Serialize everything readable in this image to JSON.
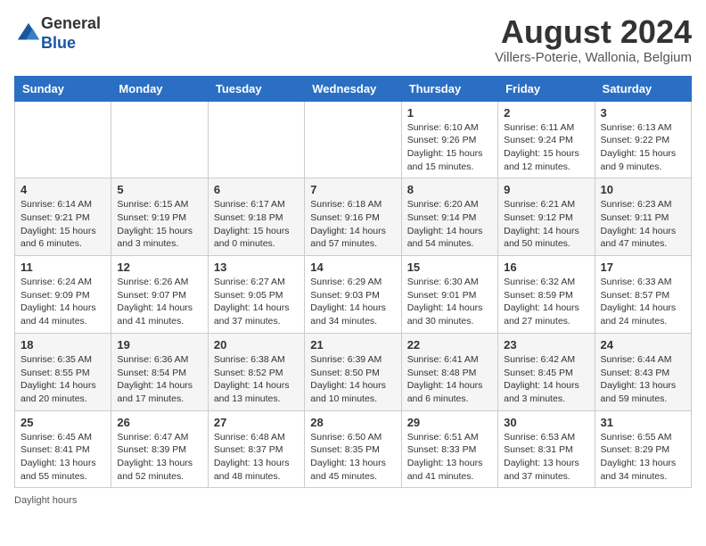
{
  "header": {
    "logo_line1": "General",
    "logo_line2": "Blue",
    "main_title": "August 2024",
    "subtitle": "Villers-Poterie, Wallonia, Belgium"
  },
  "days_of_week": [
    "Sunday",
    "Monday",
    "Tuesday",
    "Wednesday",
    "Thursday",
    "Friday",
    "Saturday"
  ],
  "footer": {
    "daylight_label": "Daylight hours"
  },
  "weeks": [
    [
      {
        "day": "",
        "info": ""
      },
      {
        "day": "",
        "info": ""
      },
      {
        "day": "",
        "info": ""
      },
      {
        "day": "",
        "info": ""
      },
      {
        "day": "1",
        "info": "Sunrise: 6:10 AM\nSunset: 9:26 PM\nDaylight: 15 hours and 15 minutes."
      },
      {
        "day": "2",
        "info": "Sunrise: 6:11 AM\nSunset: 9:24 PM\nDaylight: 15 hours and 12 minutes."
      },
      {
        "day": "3",
        "info": "Sunrise: 6:13 AM\nSunset: 9:22 PM\nDaylight: 15 hours and 9 minutes."
      }
    ],
    [
      {
        "day": "4",
        "info": "Sunrise: 6:14 AM\nSunset: 9:21 PM\nDaylight: 15 hours and 6 minutes."
      },
      {
        "day": "5",
        "info": "Sunrise: 6:15 AM\nSunset: 9:19 PM\nDaylight: 15 hours and 3 minutes."
      },
      {
        "day": "6",
        "info": "Sunrise: 6:17 AM\nSunset: 9:18 PM\nDaylight: 15 hours and 0 minutes."
      },
      {
        "day": "7",
        "info": "Sunrise: 6:18 AM\nSunset: 9:16 PM\nDaylight: 14 hours and 57 minutes."
      },
      {
        "day": "8",
        "info": "Sunrise: 6:20 AM\nSunset: 9:14 PM\nDaylight: 14 hours and 54 minutes."
      },
      {
        "day": "9",
        "info": "Sunrise: 6:21 AM\nSunset: 9:12 PM\nDaylight: 14 hours and 50 minutes."
      },
      {
        "day": "10",
        "info": "Sunrise: 6:23 AM\nSunset: 9:11 PM\nDaylight: 14 hours and 47 minutes."
      }
    ],
    [
      {
        "day": "11",
        "info": "Sunrise: 6:24 AM\nSunset: 9:09 PM\nDaylight: 14 hours and 44 minutes."
      },
      {
        "day": "12",
        "info": "Sunrise: 6:26 AM\nSunset: 9:07 PM\nDaylight: 14 hours and 41 minutes."
      },
      {
        "day": "13",
        "info": "Sunrise: 6:27 AM\nSunset: 9:05 PM\nDaylight: 14 hours and 37 minutes."
      },
      {
        "day": "14",
        "info": "Sunrise: 6:29 AM\nSunset: 9:03 PM\nDaylight: 14 hours and 34 minutes."
      },
      {
        "day": "15",
        "info": "Sunrise: 6:30 AM\nSunset: 9:01 PM\nDaylight: 14 hours and 30 minutes."
      },
      {
        "day": "16",
        "info": "Sunrise: 6:32 AM\nSunset: 8:59 PM\nDaylight: 14 hours and 27 minutes."
      },
      {
        "day": "17",
        "info": "Sunrise: 6:33 AM\nSunset: 8:57 PM\nDaylight: 14 hours and 24 minutes."
      }
    ],
    [
      {
        "day": "18",
        "info": "Sunrise: 6:35 AM\nSunset: 8:55 PM\nDaylight: 14 hours and 20 minutes."
      },
      {
        "day": "19",
        "info": "Sunrise: 6:36 AM\nSunset: 8:54 PM\nDaylight: 14 hours and 17 minutes."
      },
      {
        "day": "20",
        "info": "Sunrise: 6:38 AM\nSunset: 8:52 PM\nDaylight: 14 hours and 13 minutes."
      },
      {
        "day": "21",
        "info": "Sunrise: 6:39 AM\nSunset: 8:50 PM\nDaylight: 14 hours and 10 minutes."
      },
      {
        "day": "22",
        "info": "Sunrise: 6:41 AM\nSunset: 8:48 PM\nDaylight: 14 hours and 6 minutes."
      },
      {
        "day": "23",
        "info": "Sunrise: 6:42 AM\nSunset: 8:45 PM\nDaylight: 14 hours and 3 minutes."
      },
      {
        "day": "24",
        "info": "Sunrise: 6:44 AM\nSunset: 8:43 PM\nDaylight: 13 hours and 59 minutes."
      }
    ],
    [
      {
        "day": "25",
        "info": "Sunrise: 6:45 AM\nSunset: 8:41 PM\nDaylight: 13 hours and 55 minutes."
      },
      {
        "day": "26",
        "info": "Sunrise: 6:47 AM\nSunset: 8:39 PM\nDaylight: 13 hours and 52 minutes."
      },
      {
        "day": "27",
        "info": "Sunrise: 6:48 AM\nSunset: 8:37 PM\nDaylight: 13 hours and 48 minutes."
      },
      {
        "day": "28",
        "info": "Sunrise: 6:50 AM\nSunset: 8:35 PM\nDaylight: 13 hours and 45 minutes."
      },
      {
        "day": "29",
        "info": "Sunrise: 6:51 AM\nSunset: 8:33 PM\nDaylight: 13 hours and 41 minutes."
      },
      {
        "day": "30",
        "info": "Sunrise: 6:53 AM\nSunset: 8:31 PM\nDaylight: 13 hours and 37 minutes."
      },
      {
        "day": "31",
        "info": "Sunrise: 6:55 AM\nSunset: 8:29 PM\nDaylight: 13 hours and 34 minutes."
      }
    ]
  ]
}
